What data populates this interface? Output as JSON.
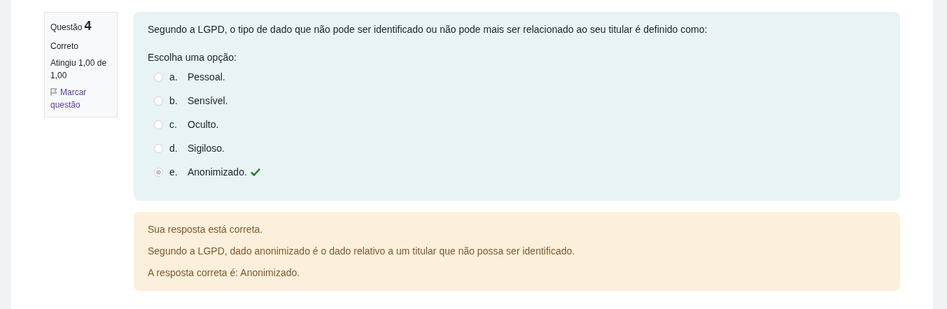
{
  "info": {
    "question_label": "Questão",
    "question_number": "4",
    "state": "Correto",
    "grade": "Atingiu 1,00 de 1,00",
    "flag_label": "Marcar questão"
  },
  "question": {
    "text": "Segundo a LGPD, o tipo de dado que não pode ser identificado ou não pode mais ser relacionado ao seu titular é definido como:",
    "prompt": "Escolha uma opção:",
    "options": [
      {
        "letter": "a.",
        "text": "Pessoal.",
        "selected": false,
        "correct": false
      },
      {
        "letter": "b.",
        "text": "Sensível.",
        "selected": false,
        "correct": false
      },
      {
        "letter": "c.",
        "text": "Oculto.",
        "selected": false,
        "correct": false
      },
      {
        "letter": "d.",
        "text": "Sigiloso.",
        "selected": false,
        "correct": false
      },
      {
        "letter": "e.",
        "text": "Anonimizado.",
        "selected": true,
        "correct": true
      }
    ]
  },
  "feedback": [
    "Sua resposta está correta.",
    "Segundo a LGPD, dado anonimizado é o dado relativo a um titular que não possa ser identificado.",
    "A resposta correta é: Anonimizado."
  ]
}
